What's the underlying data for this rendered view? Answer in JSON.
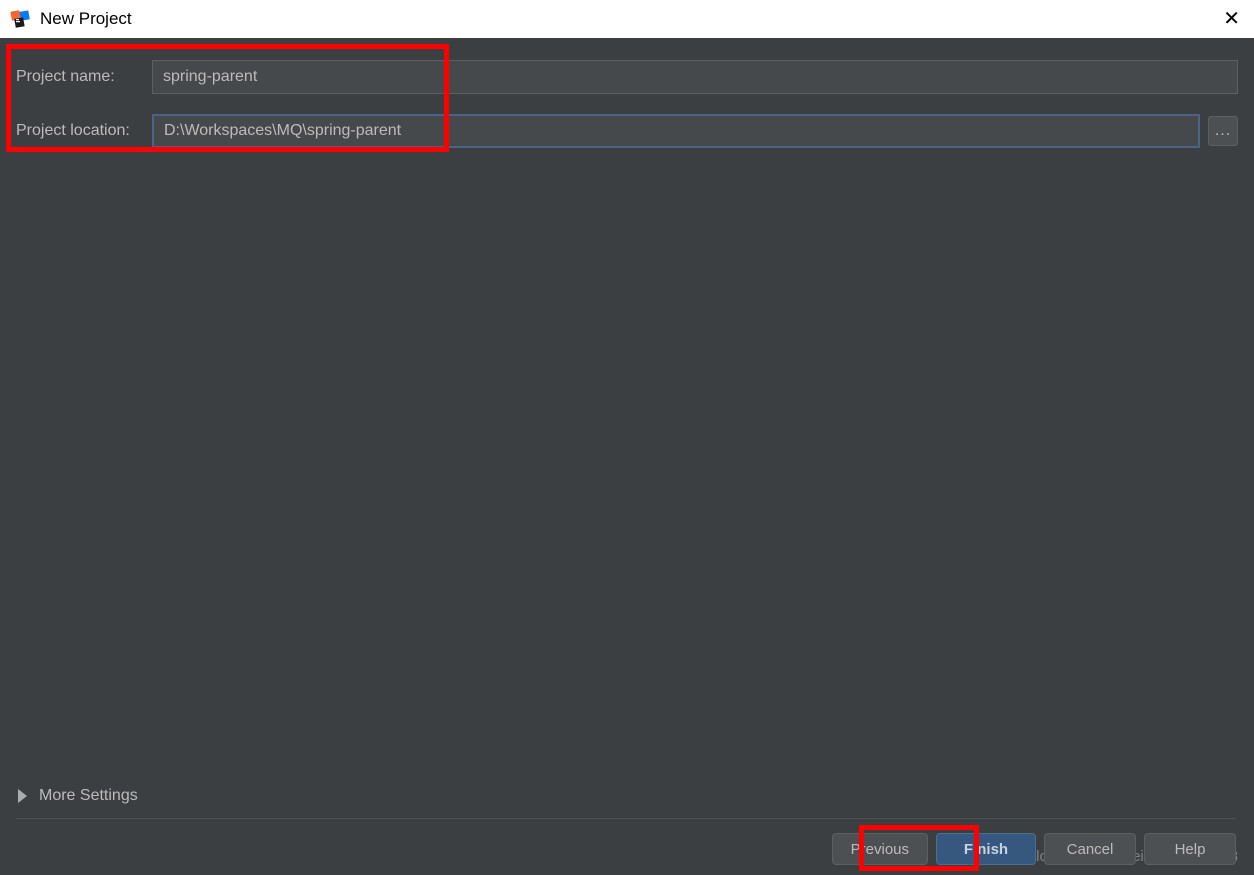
{
  "window": {
    "title": "New Project"
  },
  "form": {
    "project_name_label": "Project name:",
    "project_name_value": "spring-parent",
    "project_location_label": "Project location:",
    "project_location_value": "D:\\Workspaces\\MQ\\spring-parent",
    "browse_label": "..."
  },
  "more_settings": {
    "label": "More Settings"
  },
  "buttons": {
    "previous": "Previous",
    "finish": "Finish",
    "cancel": "Cancel",
    "help": "Help"
  },
  "watermark": "https://blog.csdn.net/weixin_40816738"
}
